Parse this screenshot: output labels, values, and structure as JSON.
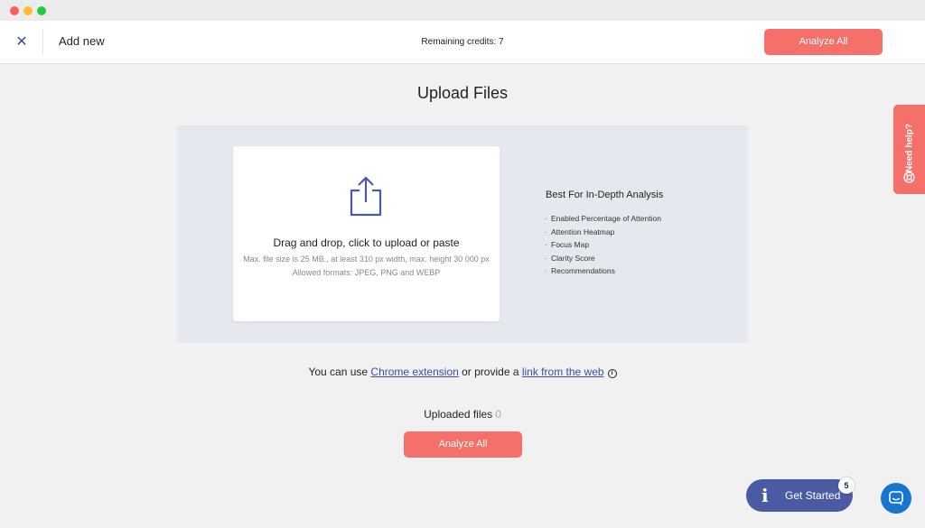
{
  "header": {
    "title": "Add new",
    "credits": "Remaining credits: 7",
    "analyze_label": "Analyze All"
  },
  "page": {
    "title": "Upload Files"
  },
  "dropzone": {
    "main_text": "Drag and drop, click to upload or paste",
    "limits_text": "Max. file size is 25 MB., at least 310 px width, max. height 30 000 px",
    "formats_text": "Allowed formats: JPEG, PNG and WEBP"
  },
  "features": {
    "title": "Best For In-Depth Analysis",
    "items": [
      "Enabled Percentage of Attention",
      "Attention Heatmap",
      "Focus Map",
      "Clarity Score",
      "Recommendations"
    ]
  },
  "chrome_line": {
    "prefix": "You can use ",
    "chrome_link": "Chrome extension",
    "middle": " or provide a ",
    "web_link": "link from the web"
  },
  "uploaded": {
    "label": "Uploaded files",
    "count": "0",
    "analyze_label": "Analyze All"
  },
  "help_tab": {
    "label": "Need help?"
  },
  "get_started": {
    "label": "Get Started",
    "badge": "5"
  },
  "colors": {
    "accent": "#f6706b",
    "brand": "#4a5ba4",
    "link": "#3d4f9a",
    "chat": "#1676d2"
  },
  "icons": {
    "close": "close-icon",
    "upload": "upload-share-icon",
    "info": "info-icon",
    "help": "lifebuoy-icon",
    "chat": "chat-icon"
  }
}
